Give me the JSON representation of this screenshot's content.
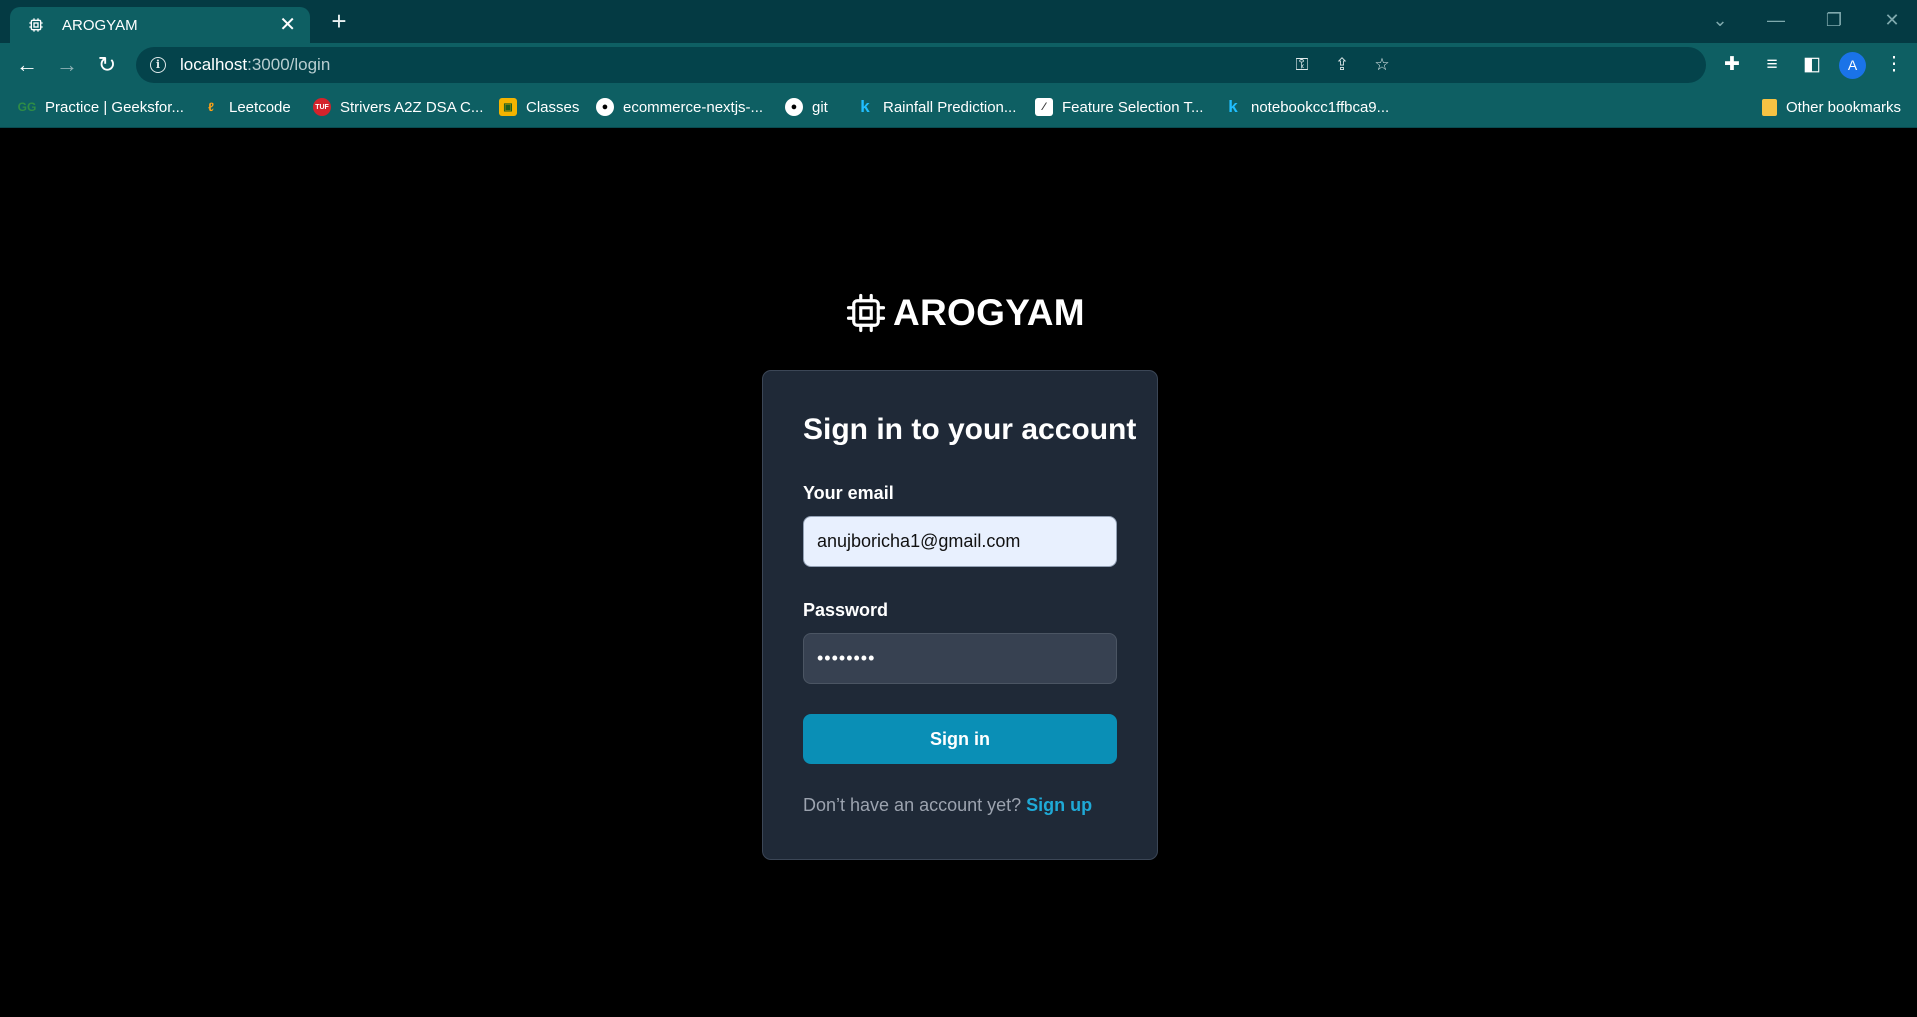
{
  "browser": {
    "tab_title": "AROGYAM",
    "url_host": "localhost",
    "url_path": ":3000/login",
    "bookmarks": [
      {
        "label": "Practice | Geeksfor...",
        "icon": "geeksforgeeks-icon"
      },
      {
        "label": "Leetcode",
        "icon": "leetcode-icon"
      },
      {
        "label": "Strivers A2Z DSA C...",
        "icon": "tuf-icon"
      },
      {
        "label": "Classes",
        "icon": "classroom-icon"
      },
      {
        "label": "ecommerce-nextjs-...",
        "icon": "github-icon"
      },
      {
        "label": "git",
        "icon": "github-icon"
      },
      {
        "label": "Rainfall Prediction...",
        "icon": "kaggle-icon"
      },
      {
        "label": "Feature Selection T...",
        "icon": "chart-icon"
      },
      {
        "label": "notebookcc1ffbca9...",
        "icon": "kaggle-icon"
      }
    ],
    "other_bookmarks": "Other bookmarks",
    "profile_initial": "A"
  },
  "page": {
    "brand": "AROGYAM",
    "title": "Sign in to your account",
    "email_label": "Your email",
    "email_value": "anujboricha1@gmail.com",
    "password_label": "Password",
    "password_value": "••••••••",
    "signin_label": "Sign in",
    "signup_prompt": "Don’t have an account yet?",
    "signup_link": "Sign up"
  },
  "colors": {
    "browser_frame": "#0e5f63",
    "page_bg": "#000000",
    "card_bg": "#1f2937",
    "primary_button": "#0a8fb6",
    "link": "#1fa9d6"
  }
}
